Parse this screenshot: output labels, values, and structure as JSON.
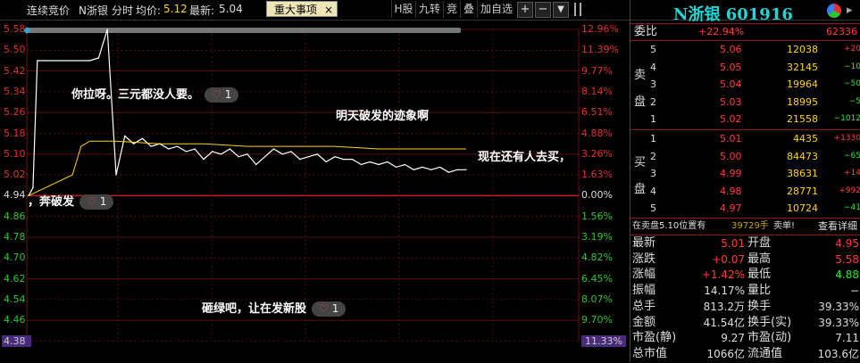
{
  "topbar": {
    "mode": "连续竞价",
    "stock": "N浙银",
    "chart_type": "分时",
    "avg_label": "均价:",
    "avg_value": "5.12",
    "latest_label": "最新:",
    "latest_value": "5.04",
    "tab_label": "重大事项",
    "tab_close": "×",
    "buttons": [
      "H股",
      "九转",
      "竞",
      "叠",
      "加自选"
    ],
    "controls": [
      "+",
      "−",
      "▼"
    ]
  },
  "chart": {
    "left_ticks": [
      "5.58",
      "5.50",
      "5.42",
      "5.34",
      "5.26",
      "5.18",
      "5.10",
      "5.02",
      "4.94",
      "4.86",
      "4.78",
      "4.70",
      "4.62",
      "4.54",
      "4.46",
      "4.38"
    ],
    "right_ticks": [
      "12.96%",
      "11.39%",
      "9.77%",
      "8.14%",
      "6.51%",
      "4.88%",
      "3.26%",
      "1.63%",
      "0.00%",
      "1.56%",
      "3.19%",
      "4.82%",
      "6.45%",
      "8.07%",
      "9.70%",
      "11.33%"
    ],
    "annotations": [
      {
        "text": "你拉呀。三元都没人要。",
        "likes": "1"
      },
      {
        "text": "明天破发的迹象啊",
        "likes": ""
      },
      {
        "text": "现在还有人去买，",
        "likes": ""
      },
      {
        "text": "，奔破发",
        "likes": "1"
      },
      {
        "text": "砸绿吧，让在发新股",
        "likes": "1"
      }
    ],
    "colors": {
      "up": "#e03030",
      "down": "#2ec52e",
      "price_line": "#ffffff",
      "avg_line": "#ffd400",
      "grid": "#8a1a1a"
    }
  },
  "chart_data": {
    "type": "line",
    "title": "",
    "ylim": [
      4.38,
      5.58
    ],
    "prev_close": 4.94,
    "series": [
      {
        "name": "",
        "x_index": [
          0,
          1,
          2,
          4,
          6,
          8,
          10,
          12,
          14,
          16,
          18,
          20,
          22,
          24,
          26,
          28,
          30,
          32,
          34,
          36,
          38,
          40,
          42,
          44,
          46,
          48,
          50,
          52,
          54,
          56,
          58,
          60,
          62,
          64,
          66,
          68,
          70,
          72,
          74,
          76,
          78,
          80,
          82,
          84,
          86,
          88,
          90,
          92,
          94,
          96,
          98,
          100
        ],
        "values": [
          4.94,
          4.97,
          5.46,
          5.46,
          5.46,
          5.46,
          5.46,
          5.46,
          5.46,
          5.47,
          5.58,
          5.02,
          5.17,
          5.14,
          5.16,
          5.13,
          5.14,
          5.12,
          5.13,
          5.11,
          5.12,
          5.08,
          5.11,
          5.1,
          5.12,
          5.09,
          5.1,
          5.06,
          5.09,
          5.12,
          5.1,
          5.11,
          5.08,
          5.09,
          5.1,
          5.07,
          5.09,
          5.08,
          5.08,
          5.06,
          5.07,
          5.06,
          5.07,
          5.05,
          5.06,
          5.04,
          5.05,
          5.04,
          5.05,
          5.03,
          5.04,
          5.04
        ]
      },
      {
        "name": "",
        "x_index": [
          0,
          10,
          12,
          14,
          20,
          30,
          40,
          50,
          60,
          70,
          80,
          90,
          100
        ],
        "values": [
          4.94,
          5.02,
          5.13,
          5.15,
          5.15,
          5.14,
          5.14,
          5.13,
          5.13,
          5.13,
          5.12,
          5.12,
          5.12
        ]
      }
    ]
  },
  "panel": {
    "title": "N浙银 601916",
    "weibi_label": "委比",
    "weibi_value": "+22.94%",
    "weibi_diff": "62336",
    "sell_label": [
      "卖",
      "盘"
    ],
    "buy_label": [
      "买",
      "盘"
    ],
    "sells": [
      {
        "level": "5",
        "price": "5.06",
        "vol": "12038",
        "chg": "+20"
      },
      {
        "level": "4",
        "price": "5.05",
        "vol": "32145",
        "chg": "−10"
      },
      {
        "level": "3",
        "price": "5.04",
        "vol": "19964",
        "chg": "−50"
      },
      {
        "level": "2",
        "price": "5.03",
        "vol": "18995",
        "chg": "−5"
      },
      {
        "level": "1",
        "price": "5.02",
        "vol": "21558",
        "chg": "−1012"
      }
    ],
    "buys": [
      {
        "level": "1",
        "price": "5.01",
        "vol": "4435",
        "chg": "+1330"
      },
      {
        "level": "2",
        "price": "5.00",
        "vol": "84473",
        "chg": "−65"
      },
      {
        "level": "3",
        "price": "4.99",
        "vol": "38631",
        "chg": "+14"
      },
      {
        "level": "4",
        "price": "4.98",
        "vol": "28771",
        "chg": "+992"
      },
      {
        "level": "5",
        "price": "4.97",
        "vol": "10724",
        "chg": "−41"
      }
    ],
    "notice_a": "在卖盘5.10位置有",
    "notice_vol": "39729手",
    "notice_b": "卖单!",
    "notice_link": "查看详细",
    "stats": [
      {
        "l1": "最新",
        "v1": "5.01",
        "c1": "red",
        "l2": "开盘",
        "v2": "4.95",
        "c2": "red"
      },
      {
        "l1": "涨跌",
        "v1": "+0.07",
        "c1": "red",
        "l2": "最高",
        "v2": "5.58",
        "c2": "red"
      },
      {
        "l1": "涨幅",
        "v1": "+1.42%",
        "c1": "red",
        "l2": "最低",
        "v2": "4.88",
        "c2": "grn"
      },
      {
        "l1": "振幅",
        "v1": "14.17%",
        "c1": "wht",
        "l2": "量比",
        "v2": "−",
        "c2": "wht"
      },
      {
        "l1": "总手",
        "v1": "813.2万",
        "c1": "wht",
        "l2": "换手",
        "v2": "39.33%",
        "c2": "wht"
      },
      {
        "l1": "金额",
        "v1": "41.54亿",
        "c1": "wht",
        "l2": "换手(实)",
        "v2": "39.33%",
        "c2": "wht"
      },
      {
        "l1": "市盈(静)",
        "v1": "9.27",
        "c1": "wht",
        "l2": "市盈(动)",
        "v2": "7.11",
        "c2": "wht"
      },
      {
        "l1": "总市值",
        "v1": "1066亿",
        "c1": "wht",
        "l2": "流通值",
        "v2": "103.6亿",
        "c2": "wht"
      }
    ]
  }
}
